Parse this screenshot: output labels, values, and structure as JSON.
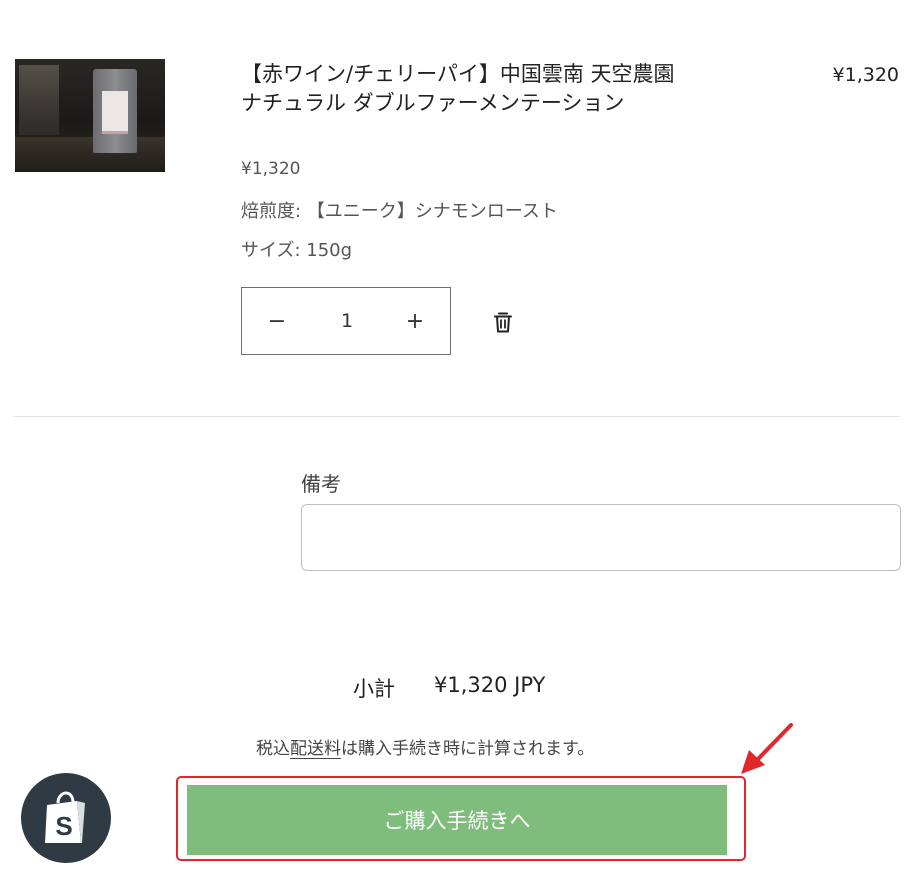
{
  "cart_item": {
    "title": "【赤ワイン/チェリーパイ】中国雲南 天空農園 ナチュラル ダブルファーメンテーション",
    "unit_price": "¥1,320",
    "line_total": "¥1,320",
    "options": [
      {
        "text": "焙煎度: 【ユニーク】シナモンロースト"
      },
      {
        "text": "サイズ: 150g"
      }
    ],
    "quantity": {
      "minus": "−",
      "value": "1",
      "plus": "+"
    },
    "remove_icon": "trash-icon"
  },
  "note": {
    "label": "備考",
    "value": ""
  },
  "summary": {
    "subtotal_label": "小計",
    "subtotal_value": "¥1,320 JPY",
    "tax_prefix": "税込",
    "tax_link": "配送料",
    "tax_suffix": "は購入手続き時に計算されます。"
  },
  "checkout": {
    "label": "ご購入手続きへ"
  },
  "colors": {
    "checkout_button": "#7ebd7b",
    "highlight": "#e3262a",
    "shopify_badge": "#2f3a45"
  },
  "icons": [
    "trash-icon",
    "red-arrow-icon",
    "shopify-bag-icon"
  ]
}
